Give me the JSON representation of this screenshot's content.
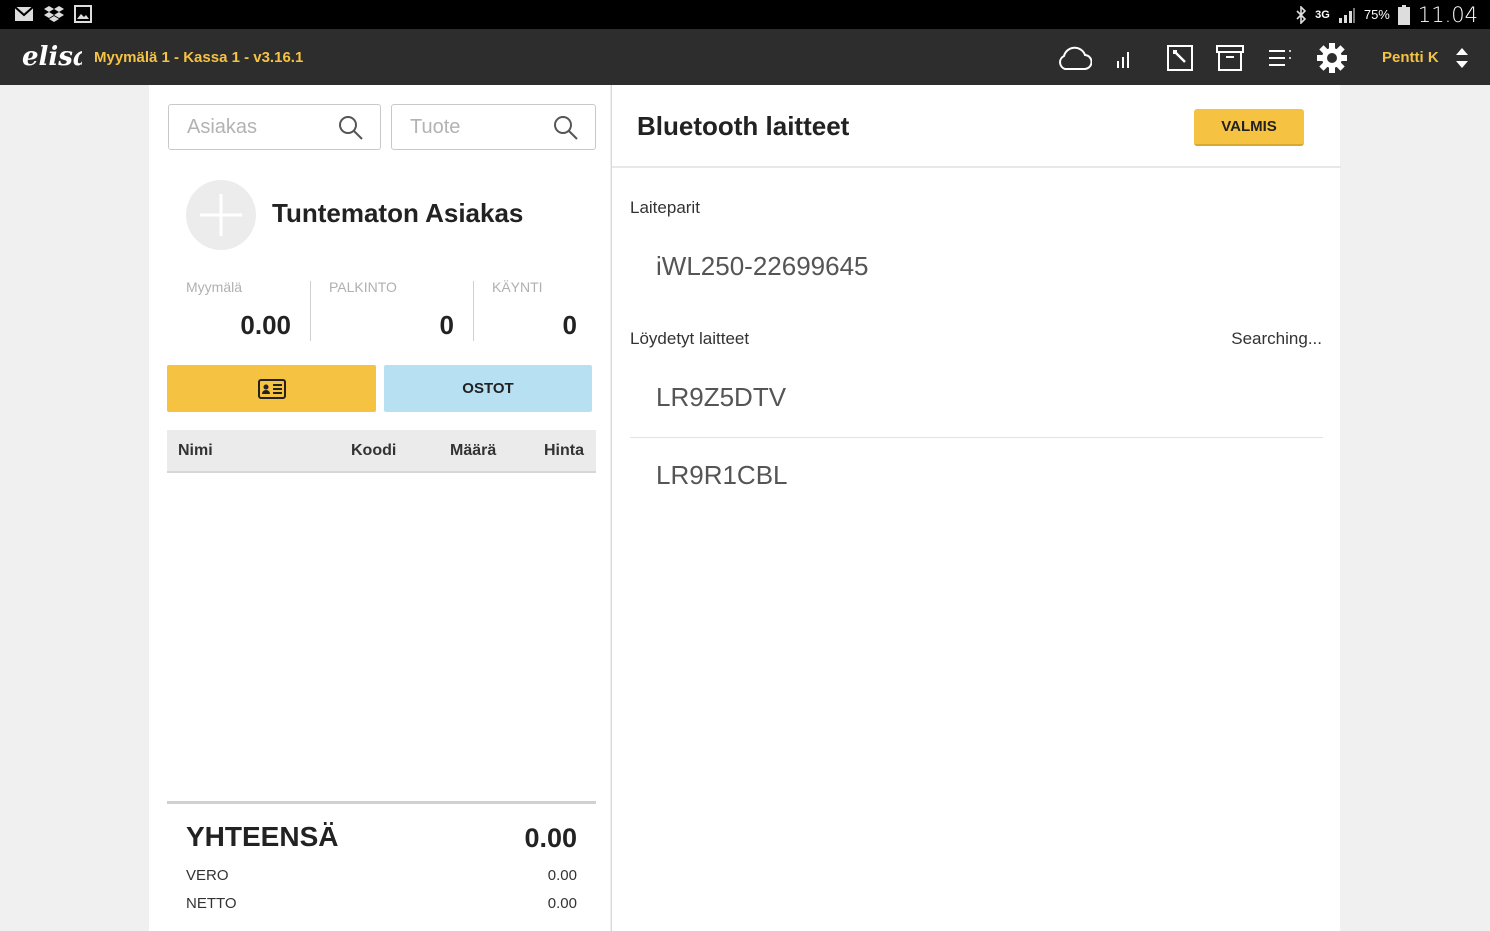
{
  "statusbar": {
    "battery_pct": "75%",
    "network": "3G",
    "time": "11.04"
  },
  "header": {
    "logo_text": "elisa",
    "store_title": "Myymälä 1 - Kassa 1 - v3.16.1",
    "user_name": "Pentti K"
  },
  "left": {
    "search_customer_placeholder": "Asiakas",
    "search_product_placeholder": "Tuote",
    "customer_name": "Tuntematon Asiakas",
    "stats": [
      {
        "label": "Myymälä",
        "value": "0.00"
      },
      {
        "label": "PALKINTO",
        "value": "0"
      },
      {
        "label": "KÄYNTI",
        "value": "0"
      }
    ],
    "ostot_label": "OSTOT",
    "table_headers": [
      "Nimi",
      "Koodi",
      "Määrä",
      "Hinta"
    ],
    "totals": {
      "total_label": "YHTEENSÄ",
      "total_value": "0.00",
      "vero_label": "VERO",
      "vero_value": "0.00",
      "netto_label": "NETTO",
      "netto_value": "0.00"
    }
  },
  "right": {
    "title": "Bluetooth laitteet",
    "done_label": "VALMIS",
    "paired_label": "Laiteparit",
    "paired_devices": [
      "iWL250-22699645"
    ],
    "found_label": "Löydetyt laitteet",
    "searching_text": "Searching...",
    "found_devices": [
      "LR9Z5DTV",
      "LR9R1CBL"
    ]
  },
  "colors": {
    "accent_yellow": "#f5c242",
    "header_bg": "#2d2d2d",
    "ostot_blue": "#b7e0f2"
  }
}
